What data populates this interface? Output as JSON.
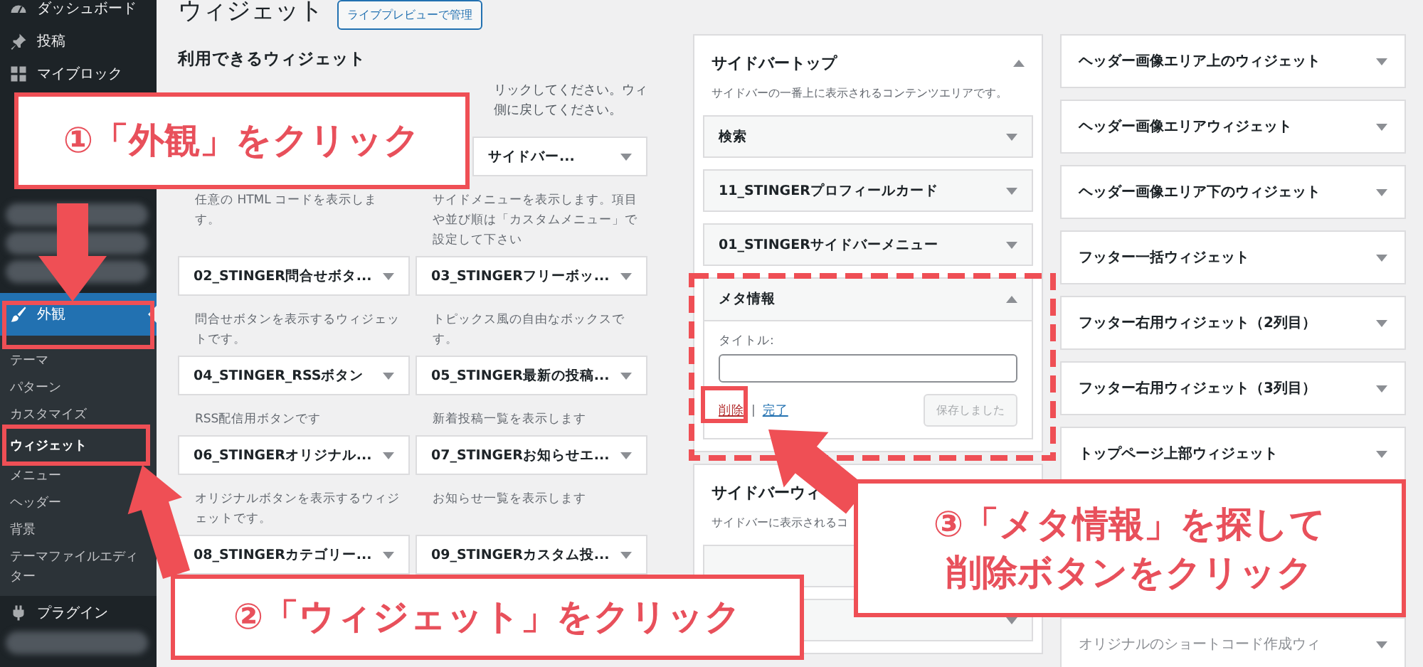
{
  "sidebar": {
    "items": [
      {
        "kind": "main",
        "label": "ダッシュボード",
        "selected": false
      },
      {
        "kind": "main",
        "label": "投稿",
        "selected": false
      },
      {
        "kind": "main",
        "label": "マイブロック",
        "selected": false
      },
      {
        "kind": "blurred"
      },
      {
        "kind": "blurred"
      },
      {
        "kind": "blurred"
      },
      {
        "kind": "main",
        "label": "外観",
        "selected": true
      },
      {
        "kind": "sub",
        "label": "テーマ",
        "selected": false
      },
      {
        "kind": "sub",
        "label": "パターン",
        "selected": false
      },
      {
        "kind": "sub",
        "label": "カスタマイズ",
        "selected": false
      },
      {
        "kind": "sub",
        "label": "ウィジェット",
        "selected": true
      },
      {
        "kind": "sub",
        "label": "メニュー",
        "selected": false
      },
      {
        "kind": "sub",
        "label": "ヘッダー",
        "selected": false
      },
      {
        "kind": "sub",
        "label": "背景",
        "selected": false
      },
      {
        "kind": "sub",
        "label": "テーマファイルエディター",
        "selected": false
      },
      {
        "kind": "main",
        "label": "プラグイン",
        "selected": false
      },
      {
        "kind": "blurred"
      }
    ]
  },
  "page": {
    "title": "ウィジェット",
    "live_preview_button": "ライブプレビューで管理"
  },
  "available_widgets": {
    "heading": "利用できるウィジェット",
    "intro": [
      "リックしてください。ウィ",
      "側に戻してください。"
    ],
    "rows": [
      [
        {
          "description": "任意の HTML コードを表示します。"
        },
        {
          "title": "サイドバー...",
          "covered": true,
          "description": "サイドメニューを表示します。項目や並び順は「カスタムメニュー」で設定して下さい"
        }
      ],
      [
        {
          "title": "02_STINGER問合せボタ...",
          "covered": false,
          "description": "問合せボタンを表示するウィジェットです。"
        },
        {
          "title": "03_STINGERフリーボッ...",
          "covered": false,
          "description": "トピックス風の自由なボックスです。"
        }
      ],
      [
        {
          "title": "04_STINGER_RSSボタン",
          "covered": false,
          "description": "RSS配信用ボタンです"
        },
        {
          "title": "05_STINGER最新の投稿...",
          "covered": false,
          "description": "新着投稿一覧を表示します"
        }
      ],
      [
        {
          "title": "06_STINGERオリジナル...",
          "covered": false,
          "description": "オリジナルボタンを表示するウィジェットです。"
        },
        {
          "title": "07_STINGERお知らせエ...",
          "covered": false,
          "description": "お知らせ一覧を表示します"
        }
      ],
      [
        {
          "title": "08_STINGERカテゴリー...",
          "covered": false
        },
        {
          "title": "09_STINGERカスタム投...",
          "covered": false
        }
      ]
    ]
  },
  "sidebar_areas": [
    {
      "title": "サイドバートップ",
      "expanded": true,
      "description": "サイドバーの一番上に表示されるコンテンツエリアです。",
      "widgets": [
        {
          "title": "検索",
          "expanded": false
        },
        {
          "title": "11_STINGERプロフィールカード",
          "expanded": false
        },
        {
          "title": "01_STINGERサイドバーメニュー",
          "expanded": false
        },
        {
          "title": "メタ情報",
          "expanded": true,
          "field_label": "タイトル:",
          "delete_link": "削除",
          "separator": "|",
          "done_link": "完了",
          "save_button": {
            "label": "保存しました",
            "disabled": true
          }
        }
      ]
    },
    {
      "title": "サイドバーウィ",
      "description": "サイドバーに表示されるコ"
    }
  ],
  "widget_areas": [
    {
      "title": "ヘッダー画像エリア上のウィジェット",
      "expanded": false
    },
    {
      "title": "ヘッダー画像エリアウィジェット",
      "expanded": false
    },
    {
      "title": "ヘッダー画像エリア下のウィジェット",
      "expanded": false
    },
    {
      "title": "フッター一括ウィジェット",
      "expanded": false
    },
    {
      "title": "フッター右用ウィジェット（2列目）",
      "expanded": false
    },
    {
      "title": "フッター右用ウィジェット（3列目）",
      "expanded": false
    },
    {
      "title": "トップページ上部ウィジェット",
      "expanded": false
    },
    {
      "title": "オリジナルのショートコード作成ウィ",
      "expanded": false
    }
  ],
  "callouts": [
    {
      "lines": [
        "①「外観」をクリック"
      ]
    },
    {
      "lines": [
        "②「ウィジェット」をクリック"
      ]
    },
    {
      "lines": [
        "③「メタ情報」を探して",
        "削除ボタンをクリック"
      ]
    }
  ]
}
